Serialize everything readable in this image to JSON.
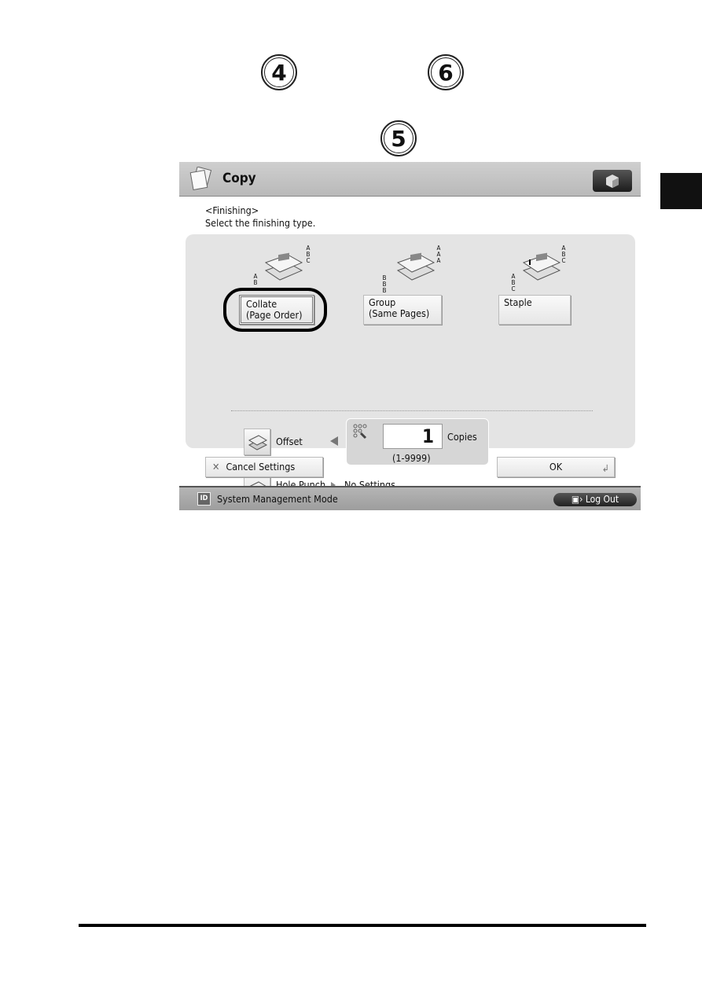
{
  "callouts": [
    "4",
    "6",
    "5"
  ],
  "header": {
    "title": "Copy",
    "icon": "copy-documents-icon",
    "menu_icon": "cube-icon"
  },
  "prompt": {
    "heading": "<Finishing>",
    "instruction": "Select the finishing type."
  },
  "finishing_options": [
    {
      "line1": "Collate",
      "line2": "(Page Order)",
      "selected": true,
      "left_letters": "A B",
      "right_letters": "A B C"
    },
    {
      "line1": "Group",
      "line2": "(Same Pages)",
      "selected": false,
      "left_letters": "B B B",
      "right_letters": "A A A"
    },
    {
      "line1": "Staple",
      "line2": "",
      "selected": false,
      "left_letters": "A B C",
      "right_letters": "A B C"
    }
  ],
  "offset": {
    "label": "Offset",
    "copies_value": "1",
    "copies_unit": "Copies",
    "range": "(1-9999)"
  },
  "hole_punch": {
    "label": "Hole Punch",
    "value": "No Settings"
  },
  "actions": {
    "cancel": "Cancel Settings",
    "ok": "OK"
  },
  "footer": {
    "mode": "System Management Mode",
    "id_badge": "ID",
    "logout": "Log Out"
  }
}
